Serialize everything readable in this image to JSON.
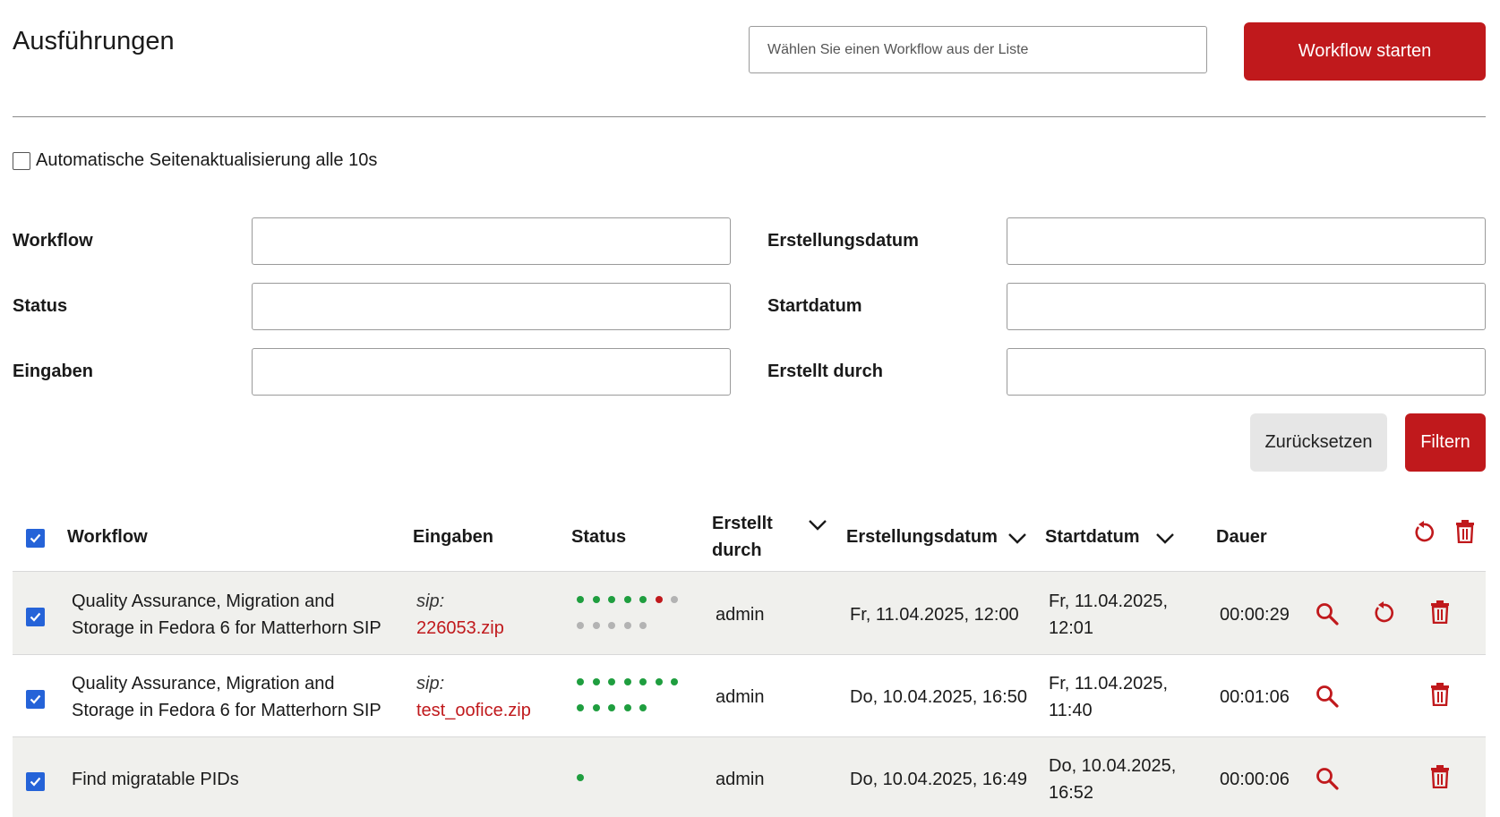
{
  "header": {
    "title": "Ausführungen",
    "workflow_placeholder": "Wählen Sie einen Workflow aus der Liste",
    "start_label": "Workflow starten"
  },
  "auto_refresh": {
    "label": "Automatische Seitenaktualisierung alle 10s",
    "checked": false
  },
  "filters": {
    "workflow": "Workflow",
    "status": "Status",
    "inputs": "Eingaben",
    "created_date": "Erstellungsdatum",
    "start_date": "Startdatum",
    "created_by": "Erstellt durch",
    "reset_label": "Zurücksetzen",
    "filter_label": "Filtern"
  },
  "table": {
    "columns": {
      "workflow": "Workflow",
      "inputs": "Eingaben",
      "status": "Status",
      "created_by_1": "Erstellt",
      "created_by_2": "durch",
      "created_date": "Erstellungsdatum",
      "start_date": "Startdatum",
      "duration": "Dauer"
    },
    "rows": [
      {
        "name_1": "Quality Assurance, Migration and",
        "name_2": "Storage in Fedora 6 for Matterhorn SIP",
        "input_label": "sip:",
        "input_file": "226053.zip",
        "status_dots": [
          "green",
          "green",
          "green",
          "green",
          "green",
          "red",
          "grey",
          "grey",
          "grey",
          "grey",
          "grey",
          "grey"
        ],
        "created_by": "admin",
        "created": "Fr, 11.04.2025, 12:00",
        "start_1": "Fr, 11.04.2025,",
        "start_2": "12:01",
        "duration": "00:00:29",
        "has_restart": true
      },
      {
        "name_1": "Quality Assurance, Migration and",
        "name_2": "Storage in Fedora 6 for Matterhorn SIP",
        "input_label": "sip:",
        "input_file": "test_oofice.zip",
        "status_dots": [
          "green",
          "green",
          "green",
          "green",
          "green",
          "green",
          "green",
          "green",
          "green",
          "green",
          "green",
          "green"
        ],
        "created_by": "admin",
        "created": "Do, 10.04.2025, 16:50",
        "start_1": "Fr, 11.04.2025,",
        "start_2": "11:40",
        "duration": "00:01:06",
        "has_restart": false
      },
      {
        "name_1": "Find migratable PIDs",
        "name_2": "",
        "input_label": "",
        "input_file": "",
        "status_dots": [
          "green"
        ],
        "created_by": "admin",
        "created": "Do, 10.04.2025, 16:49",
        "start_1": "Do, 10.04.2025,",
        "start_2": "16:52",
        "duration": "00:00:06",
        "has_restart": false
      }
    ]
  },
  "colors": {
    "accent": "#c0191c",
    "checkbox": "#2563d8",
    "dot_green": "#1f9e3f",
    "dot_red": "#c0191c",
    "dot_grey": "#b3b3b3"
  }
}
